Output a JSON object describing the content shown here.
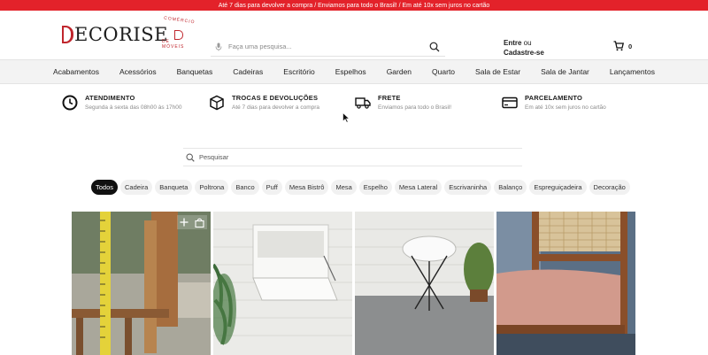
{
  "topbar": {
    "text": "Até 7 dias para devolver a compra  /  Enviamos para todo o Brasil!  /  Em até 10x sem juros no cartão",
    "bg_color": "#e3222a"
  },
  "header": {
    "logo_text": "ECORISE",
    "logo_arc_top": "COMÉRCIO",
    "logo_arc_bottom": "DE MÓVEIS",
    "search_placeholder": "Faça uma pesquisa...",
    "account_login": "Entre",
    "account_or": " ou",
    "account_signup": "Cadastre-se",
    "cart_count": "0",
    "icons": {
      "mic": "microphone-icon",
      "search": "search-icon",
      "cart": "cart-icon"
    }
  },
  "nav": {
    "items": [
      "Acabamentos",
      "Acessórios",
      "Banquetas",
      "Cadeiras",
      "Escritório",
      "Espelhos",
      "Garden",
      "Quarto",
      "Sala de Estar",
      "Sala de Jantar",
      "Lançamentos"
    ]
  },
  "benefits": [
    {
      "title": "ATENDIMENTO",
      "subtitle": "Segunda à sexta das 08h00 às 17h00",
      "icon": "clock-icon"
    },
    {
      "title": "TROCAS E DEVOLUÇÕES",
      "subtitle": "Até 7 dias para devolver a compra",
      "icon": "box-icon"
    },
    {
      "title": "FRETE",
      "subtitle": "Enviamos para todo o Brasil!",
      "icon": "truck-icon"
    },
    {
      "title": "PARCELAMENTO",
      "subtitle": "Em até 10x sem juros no cartão",
      "icon": "credit-card-icon"
    }
  ],
  "gallery": {
    "search_placeholder": "Pesquisar",
    "chips": [
      "Todos",
      "Cadeira",
      "Banqueta",
      "Poltrona",
      "Banco",
      "Puff",
      "Mesa Bistrô",
      "Mesa",
      "Espelho",
      "Mesa Lateral",
      "Escrivaninha",
      "Balanço",
      "Espreguiçadeira",
      "Decoração"
    ],
    "active_chip": "Todos"
  },
  "colors": {
    "brand_red": "#c0262d",
    "chip_active": "#111111"
  }
}
